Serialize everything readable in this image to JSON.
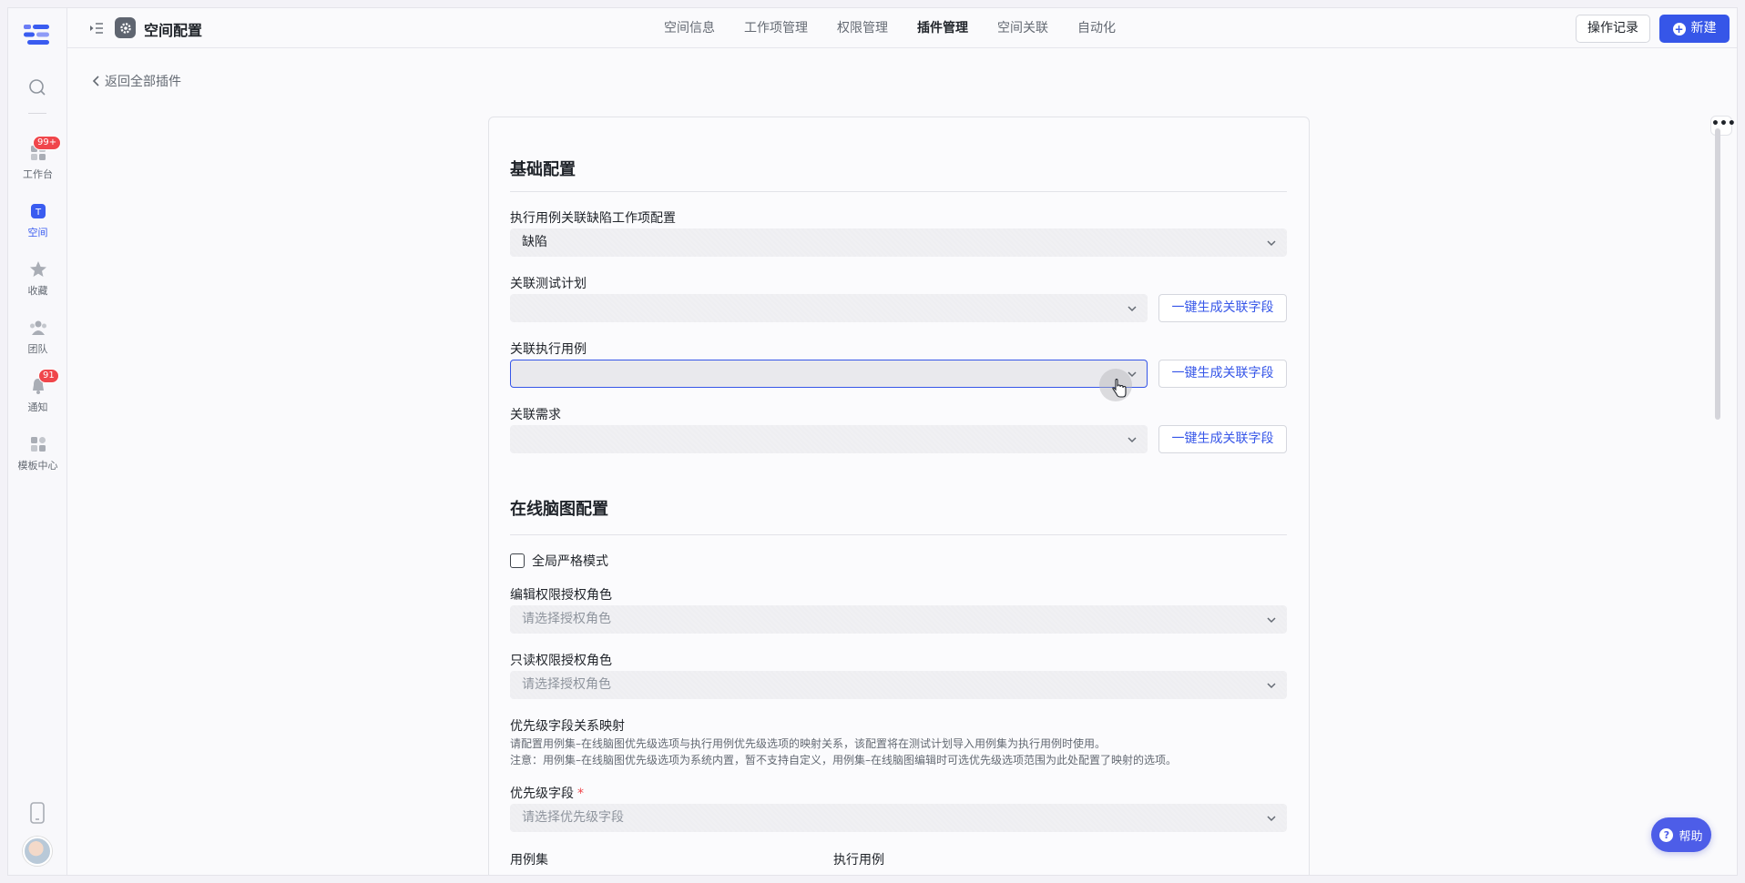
{
  "header": {
    "title": "空间配置",
    "tabs": [
      {
        "label": "空间信息"
      },
      {
        "label": "工作项管理"
      },
      {
        "label": "权限管理"
      },
      {
        "label": "插件管理"
      },
      {
        "label": "空间关联"
      },
      {
        "label": "自动化"
      }
    ],
    "active_tab": "插件管理",
    "log_button": "操作记录",
    "new_button": "新建"
  },
  "rail": {
    "items": [
      {
        "label": "工作台",
        "badge": "99+"
      },
      {
        "label": "空间",
        "active": true
      },
      {
        "label": "收藏"
      },
      {
        "label": "团队"
      },
      {
        "label": "通知",
        "badge": "91"
      },
      {
        "label": "模板中心"
      }
    ]
  },
  "back_link": "返回全部插件",
  "basic": {
    "title": "基础配置",
    "defect_config": {
      "label": "执行用例关联缺陷工作项配置",
      "value": "缺陷"
    },
    "test_plan": {
      "label": "关联测试计划",
      "value": "",
      "button": "一键生成关联字段"
    },
    "exec_case": {
      "label": "关联执行用例",
      "value": "",
      "button": "一键生成关联字段"
    },
    "requirement": {
      "label": "关联需求",
      "value": "",
      "button": "一键生成关联字段"
    }
  },
  "mindmap": {
    "title": "在线脑图配置",
    "strict_mode": {
      "label": "全局严格模式",
      "checked": false
    },
    "edit_role": {
      "label": "编辑权限授权角色",
      "placeholder": "请选择授权角色"
    },
    "read_role": {
      "label": "只读权限授权角色",
      "placeholder": "请选择授权角色"
    },
    "priority_map": {
      "label": "优先级字段关系映射",
      "hint1": "请配置用例集–在线脑图优先级选项与执行用例优先级选项的映射关系，该配置将在测试计划导入用例集为执行用例时使用。",
      "hint2": "注意：用例集–在线脑图优先级选项为系统内置，暂不支持自定义，用例集–在线脑图编辑时可选优先级选项范围为此处配置了映射的选项。"
    },
    "priority_field": {
      "label": "优先级字段",
      "required": "*",
      "placeholder": "请选择优先级字段"
    },
    "col_left": "用例集",
    "col_right": "执行用例"
  },
  "help": "帮助",
  "more": "•••",
  "colors": {
    "accent": "#3656e8",
    "badge": "#f0464b"
  }
}
